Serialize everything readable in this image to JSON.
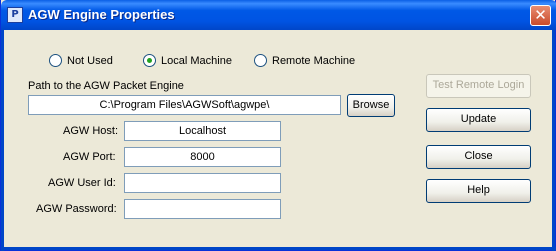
{
  "window": {
    "title": "AGW Engine Properties",
    "icon": "app-icon",
    "close_glyph": "✕"
  },
  "modes": [
    {
      "label": "Not Used",
      "checked": false
    },
    {
      "label": "Local Machine",
      "checked": true
    },
    {
      "label": "Remote Machine",
      "checked": false
    }
  ],
  "path": {
    "label": "Path to the AGW Packet Engine",
    "value": "C:\\Program Files\\AGWSoft\\agwpe\\",
    "browse_label": "Browse"
  },
  "host": {
    "label": "AGW Host:",
    "value": "Localhost"
  },
  "port": {
    "label": "AGW Port:",
    "value": "8000"
  },
  "user": {
    "label": "AGW User Id:",
    "value": ""
  },
  "password": {
    "label": "AGW Password:",
    "value": ""
  },
  "buttons": {
    "test_remote": "Test Remote Login",
    "update": "Update",
    "close": "Close",
    "help": "Help"
  }
}
